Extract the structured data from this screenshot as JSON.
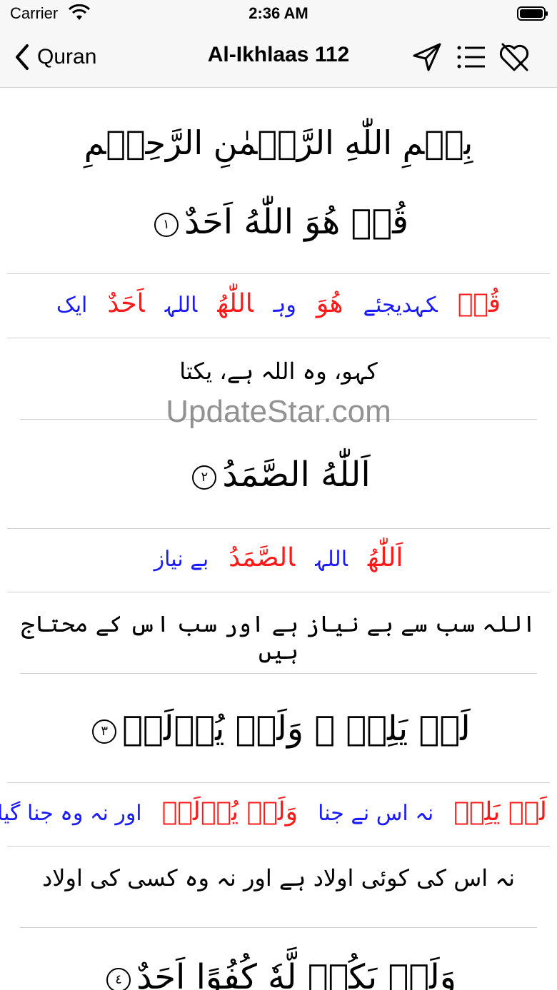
{
  "status": {
    "carrier": "Carrier",
    "time": "2:36 AM"
  },
  "nav": {
    "back_label": "Quran",
    "title": "Al-Ikhlaas 112"
  },
  "bismillah": "بِسۡمِ اللّٰهِ الرَّحۡمٰنِ الرَّحِيۡمِ",
  "ayahs": [
    {
      "arabic": "قُلۡ هُوَ اللّٰهُ اَحَدٌ",
      "number": "١",
      "words": [
        {
          "ar": "قُلۡ",
          "ur": "کہدیجئے"
        },
        {
          "ar": "هُوَ",
          "ur": "وہ"
        },
        {
          "ar": "اللّٰهُ",
          "ur": "اللہ"
        },
        {
          "ar": "اَحَدٌ",
          "ur": "ایک"
        }
      ],
      "translation": "کہو، وہ اللہ ہے، یکتا"
    },
    {
      "arabic": "اَللّٰهُ الصَّمَدُ",
      "number": "٢",
      "words": [
        {
          "ar": "اَللّٰهُ",
          "ur": "اللہ"
        },
        {
          "ar": "الصَّمَدُ",
          "ur": "بے نیاز"
        }
      ],
      "translation": "اللہ سب سے بے نیاز ہے اور سب اس کے محتاج ہیں"
    },
    {
      "arabic": "لَمۡ يَلِدۡ ۙ وَلَمۡ يُوۡلَدۡ",
      "number": "٣",
      "words": [
        {
          "ar": "لَمۡ يَلِدۡ",
          "ur": "نہ اس نے جنا"
        },
        {
          "ar": "وَلَمۡ يُوۡلَدۡ",
          "ur": "اور نہ وہ جنا گیا"
        }
      ],
      "translation": "نہ اس کی کوئی اولاد ہے اور نہ وہ کسی کی اولاد"
    },
    {
      "arabic": "وَلَمۡ يَكُنۡ لَّهٗ كُفُوًا اَحَدٌ",
      "number": "٤"
    }
  ],
  "watermark": "UpdateStar.com",
  "colors": {
    "arabic_word": "#ff1a1a",
    "urdu_word": "#1a1aff",
    "divider": "#cfcfcf"
  }
}
